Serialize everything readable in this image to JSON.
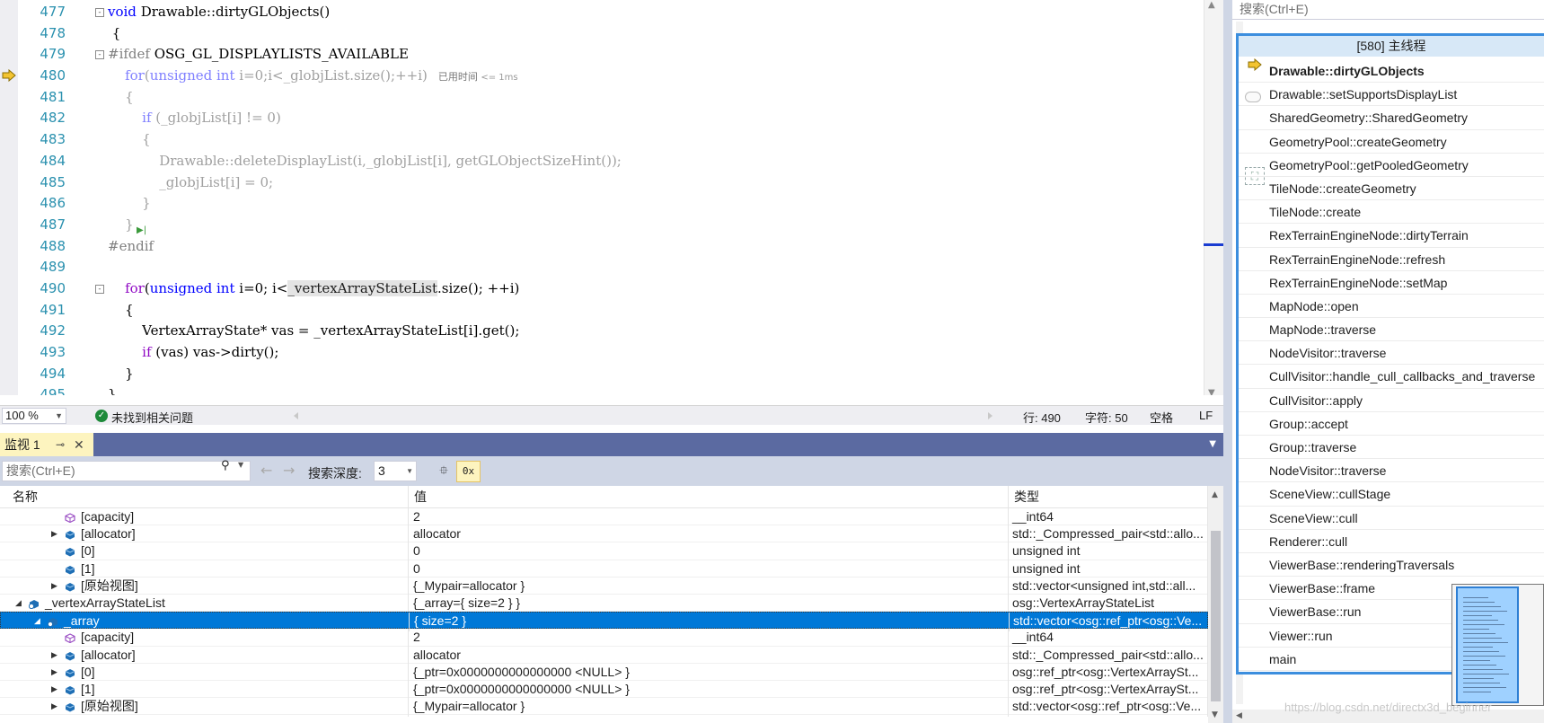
{
  "editor": {
    "lines": [
      {
        "num": "477",
        "fold": "-",
        "parts": [
          {
            "t": "void ",
            "c": "tok-kw"
          },
          {
            "t": "Drawable::dirtyGLObjects()",
            "c": "tok-fn"
          }
        ]
      },
      {
        "num": "478",
        "fold": "",
        "parts": [
          {
            "t": " {",
            "c": "tok-fn"
          }
        ]
      },
      {
        "num": "479",
        "fold": "-",
        "parts": [
          {
            "t": "#ifdef ",
            "c": "tok-pp"
          },
          {
            "t": "OSG_GL_DISPLAYLISTS_AVAILABLE",
            "c": "tok-fn"
          }
        ]
      },
      {
        "num": "480",
        "fold": "",
        "parts": [
          {
            "t": "    for",
            "c": "dim-kw"
          },
          {
            "t": "(",
            "c": "dim"
          },
          {
            "t": "unsigned int",
            "c": "dim-kw"
          },
          {
            "t": " i=0;i<_globjList.size();++i)",
            "c": "dim"
          }
        ],
        "tip": "已用时间 ",
        "tip_small": "<= 1ms"
      },
      {
        "num": "481",
        "fold": "",
        "parts": [
          {
            "t": "    {",
            "c": "dim"
          }
        ]
      },
      {
        "num": "482",
        "fold": "",
        "parts": [
          {
            "t": "        if",
            "c": "dim-kw"
          },
          {
            "t": " (_globjList[i] != 0)",
            "c": "dim"
          }
        ]
      },
      {
        "num": "483",
        "fold": "",
        "parts": [
          {
            "t": "        {",
            "c": "dim"
          }
        ]
      },
      {
        "num": "484",
        "fold": "",
        "parts": [
          {
            "t": "            Drawable::deleteDisplayList(i,_globjList[i], getGLObjectSizeHint());",
            "c": "dim"
          }
        ]
      },
      {
        "num": "485",
        "fold": "",
        "parts": [
          {
            "t": "            _globjList[i] = 0;",
            "c": "dim"
          }
        ]
      },
      {
        "num": "486",
        "fold": "",
        "parts": [
          {
            "t": "        }",
            "c": "dim"
          }
        ]
      },
      {
        "num": "487",
        "fold": "",
        "parts": [
          {
            "t": "    }",
            "c": "dim"
          }
        ],
        "step": true
      },
      {
        "num": "488",
        "fold": "",
        "parts": [
          {
            "t": "#endif",
            "c": "tok-pp"
          }
        ]
      },
      {
        "num": "489",
        "fold": "",
        "parts": [
          {
            "t": "",
            "c": "tok-fn"
          }
        ]
      },
      {
        "num": "490",
        "fold": "-",
        "parts": [
          {
            "t": "    for",
            "c": "tok-purple"
          },
          {
            "t": "(",
            "c": "tok-fn"
          },
          {
            "t": "unsigned int",
            "c": "tok-kw"
          },
          {
            "t": " i=0; i<",
            "c": "tok-fn"
          },
          {
            "t": "_vertexArrayStateList",
            "c": "hl-ident"
          },
          {
            "t": ".size(); ++i)",
            "c": "tok-fn"
          }
        ]
      },
      {
        "num": "491",
        "fold": "",
        "parts": [
          {
            "t": "    {",
            "c": "tok-fn"
          }
        ]
      },
      {
        "num": "492",
        "fold": "",
        "parts": [
          {
            "t": "        VertexArrayState* vas = _vertexArrayStateList[i].get();",
            "c": "tok-fn"
          }
        ]
      },
      {
        "num": "493",
        "fold": "",
        "parts": [
          {
            "t": "        if",
            "c": "tok-purple"
          },
          {
            "t": " (vas) vas->dirty();",
            "c": "tok-fn"
          }
        ]
      },
      {
        "num": "494",
        "fold": "",
        "parts": [
          {
            "t": "    }",
            "c": "tok-fn"
          }
        ]
      },
      {
        "num": "495",
        "fold": "",
        "parts": [
          {
            "t": "}",
            "c": "tok-fn"
          }
        ]
      }
    ]
  },
  "status": {
    "zoom": "100 %",
    "issues": "未找到相关问题",
    "line": "行: 490",
    "char": "字符: 50",
    "whitespace": "空格",
    "eol": "LF"
  },
  "watch": {
    "tab_label": "监视 1",
    "search_placeholder": "搜索(Ctrl+E)",
    "depth_label": "搜索深度:",
    "depth_value": "3",
    "columns": {
      "name": "名称",
      "value": "值",
      "type": "类型"
    },
    "rows": [
      {
        "indent": 3,
        "expander": "",
        "icon": "field",
        "name": "[capacity]",
        "value": "2",
        "type": "__int64"
      },
      {
        "indent": 3,
        "expander": "▶",
        "icon": "object",
        "name": "[allocator]",
        "value": "allocator",
        "type": "std::_Compressed_pair<std::allo..."
      },
      {
        "indent": 3,
        "expander": "",
        "icon": "object",
        "name": "[0]",
        "value": "0",
        "type": "unsigned int"
      },
      {
        "indent": 3,
        "expander": "",
        "icon": "object",
        "name": "[1]",
        "value": "0",
        "type": "unsigned int"
      },
      {
        "indent": 3,
        "expander": "▶",
        "icon": "object",
        "name": "[原始视图]",
        "value": "{_Mypair=allocator }",
        "type": "std::vector<unsigned int,std::all..."
      },
      {
        "indent": 1,
        "expander": "◢",
        "icon": "watch",
        "name": "_vertexArrayStateList",
        "value": "{_array={ size=2 } }",
        "type": "osg::VertexArrayStateList"
      },
      {
        "indent": 2,
        "expander": "◢",
        "icon": "watch",
        "name": "_array",
        "value": "{ size=2 }",
        "type": "std::vector<osg::ref_ptr<osg::Ve...",
        "selected": true
      },
      {
        "indent": 3,
        "expander": "",
        "icon": "field",
        "name": "[capacity]",
        "value": "2",
        "type": "__int64"
      },
      {
        "indent": 3,
        "expander": "▶",
        "icon": "object",
        "name": "[allocator]",
        "value": "allocator",
        "type": "std::_Compressed_pair<std::allo..."
      },
      {
        "indent": 3,
        "expander": "▶",
        "icon": "object",
        "name": "[0]",
        "value": "{_ptr=0x0000000000000000 <NULL> }",
        "type": "osg::ref_ptr<osg::VertexArraySt..."
      },
      {
        "indent": 3,
        "expander": "▶",
        "icon": "object",
        "name": "[1]",
        "value": "{_ptr=0x0000000000000000 <NULL> }",
        "type": "osg::ref_ptr<osg::VertexArraySt..."
      },
      {
        "indent": 3,
        "expander": "▶",
        "icon": "object",
        "name": "[原始视图]",
        "value": "{_Mypair=allocator }",
        "type": "std::vector<osg::ref_ptr<osg::Ve..."
      }
    ]
  },
  "callstack": {
    "search_placeholder": "搜索(Ctrl+E)",
    "title": "[580] 主线程",
    "frames": [
      "Drawable::dirtyGLObjects",
      "Drawable::setSupportsDisplayList",
      "SharedGeometry::SharedGeometry",
      "GeometryPool::createGeometry",
      "GeometryPool::getPooledGeometry",
      "TileNode::createGeometry",
      "TileNode::create",
      "RexTerrainEngineNode::dirtyTerrain",
      "RexTerrainEngineNode::refresh",
      "RexTerrainEngineNode::setMap",
      "MapNode::open",
      "MapNode::traverse",
      "NodeVisitor::traverse",
      "CullVisitor::handle_cull_callbacks_and_traverse",
      "CullVisitor::apply",
      "Group::accept",
      "Group::traverse",
      "NodeVisitor::traverse",
      "SceneView::cullStage",
      "SceneView::cull",
      "Renderer::cull",
      "ViewerBase::renderingTraversals",
      "ViewerBase::frame",
      "ViewerBase::run",
      "Viewer::run",
      "main"
    ],
    "watermark": "https://blog.csdn.net/directx3d_beginner"
  },
  "colors": {
    "accent": "#0078d7",
    "tab_active": "#fdf4bf",
    "tool_window_bar": "#5b6aa1",
    "callstack_border": "#3c8ede"
  }
}
